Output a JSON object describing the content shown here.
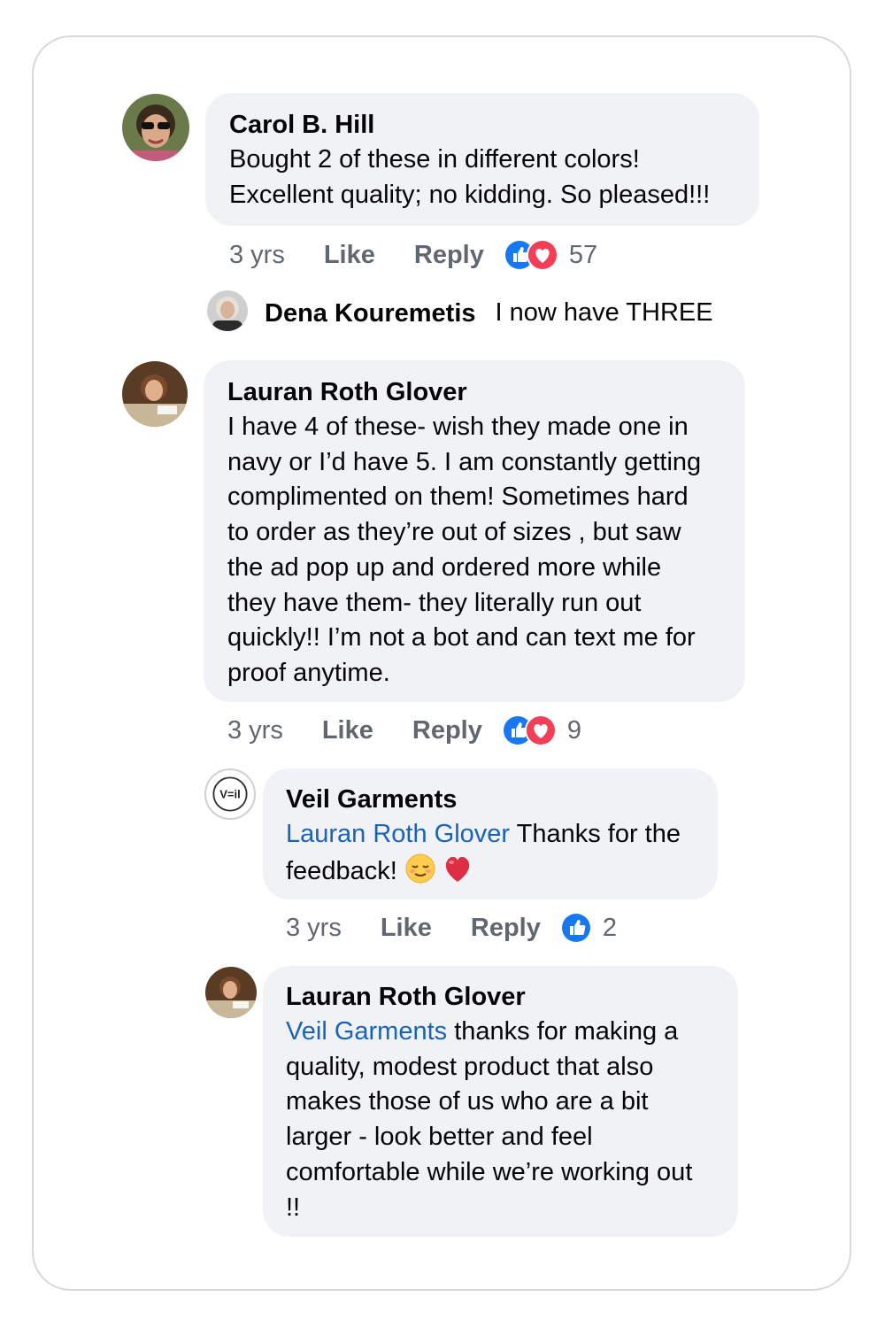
{
  "comments": [
    {
      "author": "Carol B. Hill",
      "lines": [
        "Bought 2 of these in different colors!",
        "Excellent quality; no kidding.  So pleased!!!"
      ],
      "time": "3 yrs",
      "like_label": "Like",
      "reply_label": "Reply",
      "reactions": [
        "like",
        "love"
      ],
      "reaction_count": "57"
    },
    {
      "author": "Dena Kouremetis",
      "text": "I now have THREE"
    },
    {
      "author": "Lauran Roth Glover",
      "lines": [
        "I have 4 of these- wish they made one in",
        "navy or I’d have 5. I am constantly getting",
        "complimented on them! Sometimes hard",
        "to order as they’re out of sizes , but saw",
        "the ad pop up and ordered more while",
        "they have them- they literally run out",
        "quickly!! I’m not a bot and can text me for",
        "proof anytime."
      ],
      "time": "3 yrs",
      "like_label": "Like",
      "reply_label": "Reply",
      "reactions": [
        "like",
        "love"
      ],
      "reaction_count": "9"
    },
    {
      "author": "Veil Garments",
      "avatar_text": "V=il",
      "mention": "Lauran Roth Glover",
      "line1_rest": " Thanks for the",
      "line2": "feedback! ",
      "emojis": [
        "relieved-face-emoji",
        "red-heart-emoji"
      ],
      "time": "3 yrs",
      "like_label": "Like",
      "reply_label": "Reply",
      "reactions": [
        "like"
      ],
      "reaction_count": "2"
    },
    {
      "author": "Lauran Roth Glover",
      "mention": "Veil Garments",
      "line1_rest": " thanks for making a",
      "lines": [
        "quality, modest product that also",
        "makes those of us who are a bit",
        "larger - look better and feel",
        "comfortable while we’re working out",
        "!!"
      ]
    }
  ],
  "colors": {
    "bubble": "#f0f2f5",
    "mention": "#1b63b8",
    "like": "#1877f2",
    "love": "#f33e58",
    "meta": "#606770"
  }
}
